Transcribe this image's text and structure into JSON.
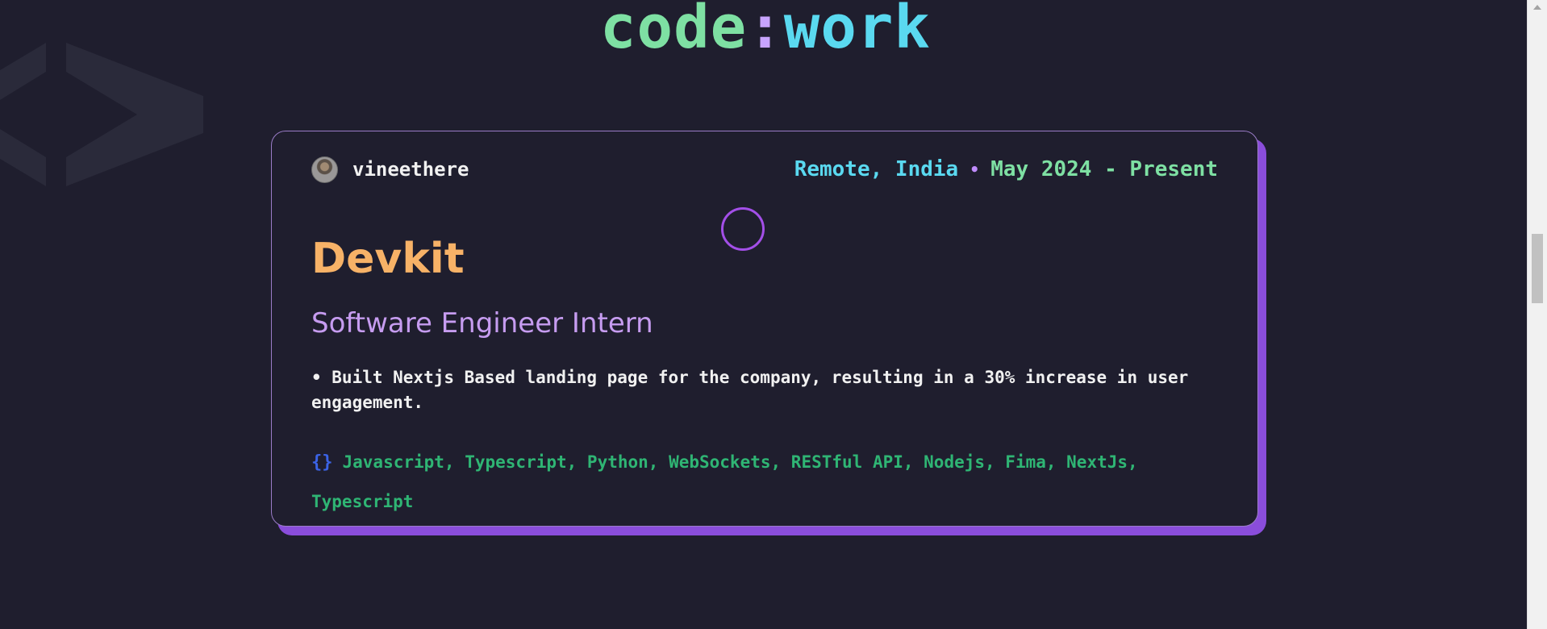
{
  "header": {
    "title_code": "code",
    "title_colon": ":",
    "title_work": "work"
  },
  "experience": {
    "author": "vineethere",
    "location": "Remote, India",
    "separator": "•",
    "period": "May 2024 - Present",
    "company": "Devkit",
    "role": "Software Engineer Intern",
    "description": "• Built Nextjs Based landing page for the company, resulting in a 30% increase in user engagement.",
    "tech_icon": "{}",
    "tech_stack": "Javascript, Typescript, Python, WebSockets, RESTful API, Nodejs, Fima, NextJs, Typescript"
  },
  "icons": {
    "background": "code-chevron-icon",
    "tech": "braces-icon",
    "loading": "loading-spinner-icon"
  },
  "colors": {
    "background": "#1f1e2e",
    "accent_purple": "#8a4ddb",
    "company": "#f7b267",
    "role": "#c69cf0",
    "location": "#5ad9f0",
    "period": "#7ee0a3",
    "tech": "#2fb574"
  }
}
